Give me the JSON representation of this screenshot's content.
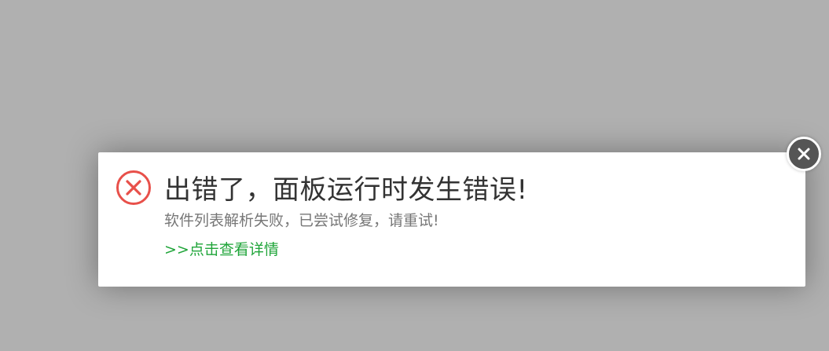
{
  "dialog": {
    "icon": "error-circle-x-icon",
    "title": "出错了，面板运行时发生错误!",
    "message": "软件列表解析失败，已尝试修复，请重试!",
    "details_link": ">>点击查看详情",
    "close_icon": "close-icon"
  },
  "colors": {
    "backdrop": "#b0b0b0",
    "error_red": "#e8504a",
    "link_green": "#20a53a",
    "close_bg": "#555555"
  }
}
